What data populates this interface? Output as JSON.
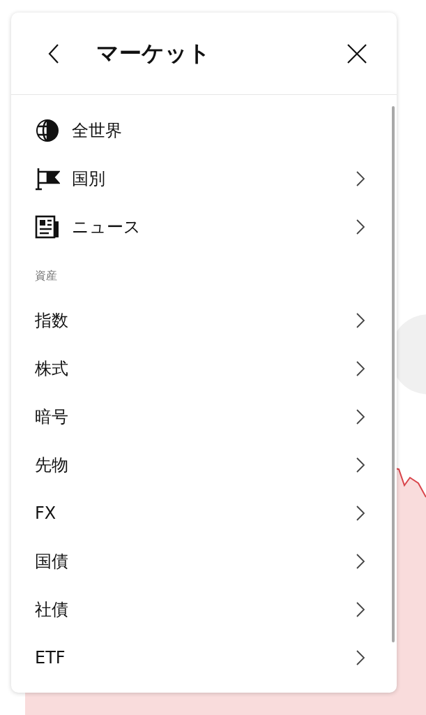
{
  "menu": {
    "title": "マーケット",
    "links": [
      {
        "label": "全世界",
        "arrow": false
      },
      {
        "label": "国別",
        "arrow": true
      },
      {
        "label": "ニュース",
        "arrow": true
      }
    ],
    "section": "資産",
    "assets": [
      {
        "label": "指数",
        "arrow": true
      },
      {
        "label": "株式",
        "arrow": true
      },
      {
        "label": "暗号",
        "arrow": true
      },
      {
        "label": "先物",
        "arrow": true
      },
      {
        "label": "FX",
        "arrow": true
      },
      {
        "label": "国債",
        "arrow": true
      },
      {
        "label": "社債",
        "arrow": true
      },
      {
        "label": "ETF",
        "arrow": true
      }
    ]
  }
}
